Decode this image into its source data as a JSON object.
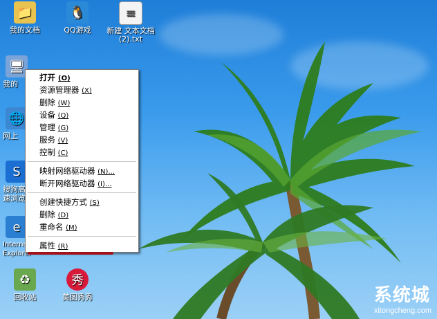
{
  "desktop_icons": [
    {
      "label": "我的文档",
      "icon": "my-documents-icon",
      "color": "#e9c34f"
    },
    {
      "label": "QQ游戏",
      "icon": "qq-game-icon",
      "color": "#2a8ad8"
    },
    {
      "label": "新建 文本文档 (2).txt",
      "icon": "text-file-icon",
      "color": "#f4f4f4"
    },
    {
      "label": "我的",
      "icon": "my-computer-icon",
      "color": "#7aa3d8"
    },
    {
      "label": "网上",
      "icon": "network-icon",
      "color": "#3b87d1"
    },
    {
      "label": "搜狗高速浏览",
      "icon": "sogou-browser-icon",
      "color": "#1b6fd2"
    },
    {
      "label": "Internet Explorer",
      "icon": "internet-explorer-icon",
      "color": "#2a7fd2"
    },
    {
      "label": "回收站",
      "icon": "recycle-bin-icon",
      "color": "#6aa84f"
    },
    {
      "label": "美图秀秀",
      "icon": "meitu-icon",
      "color": "#d81a3a"
    }
  ],
  "context_menu": {
    "items": [
      {
        "label": "打开",
        "key": "(O)",
        "bold": true
      },
      {
        "label": "资源管理器",
        "key": "(X)"
      },
      {
        "label": "删除",
        "key": "(W)"
      },
      {
        "label": "设备",
        "key": "(Q)"
      },
      {
        "label": "管理",
        "key": "(G)"
      },
      {
        "label": "服务",
        "key": "(V)"
      },
      {
        "label": "控制",
        "key": "(C)"
      }
    ],
    "items2": [
      {
        "label": "映射网络驱动器",
        "key": "(N)..."
      },
      {
        "label": "断开网络驱动器",
        "key": "(I)..."
      }
    ],
    "items3": [
      {
        "label": "创建快捷方式",
        "key": "(S)"
      },
      {
        "label": "删除",
        "key": "(D)"
      },
      {
        "label": "重命名",
        "key": "(M)"
      }
    ],
    "items4": [
      {
        "label": "属性",
        "key": "(R)"
      }
    ]
  },
  "watermark": {
    "logo": "系统城",
    "site": "xitongcheng.com"
  }
}
